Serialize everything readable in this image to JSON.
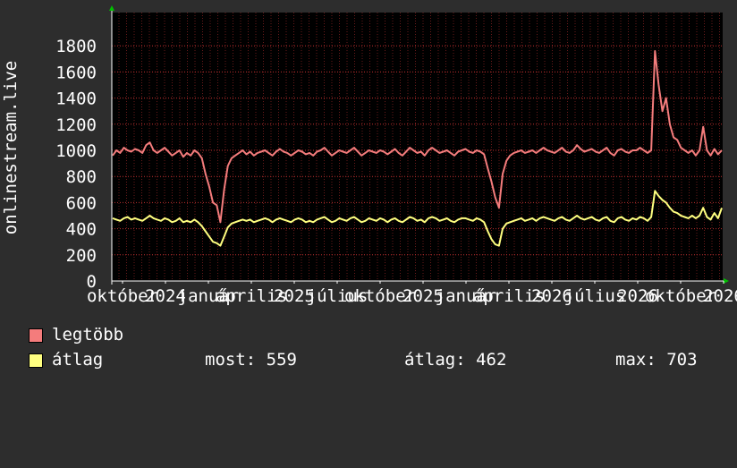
{
  "chart_data": {
    "type": "line",
    "ylabel": "onlinestream.live",
    "ylim": [
      0,
      2000
    ],
    "yticks": [
      0,
      200,
      400,
      600,
      800,
      1000,
      1200,
      1400,
      1600,
      1800
    ],
    "grid": true,
    "xtick_labels": [
      "október",
      "2024",
      "január",
      "április",
      "2025",
      "július",
      "október",
      "2025",
      "január",
      "április",
      "2026",
      "július",
      "2026",
      "október",
      "2026"
    ],
    "series": [
      {
        "name": "legtöbb",
        "color": "#f47c7c",
        "values": [
          960,
          1000,
          980,
          1020,
          1000,
          990,
          1010,
          1000,
          980,
          1040,
          1060,
          1000,
          980,
          1000,
          1020,
          990,
          960,
          980,
          1000,
          950,
          980,
          960,
          1000,
          980,
          940,
          820,
          720,
          600,
          580,
          450,
          700,
          880,
          940,
          960,
          980,
          1000,
          970,
          990,
          960,
          980,
          990,
          1000,
          980,
          960,
          990,
          1010,
          990,
          980,
          960,
          980,
          1000,
          990,
          970,
          980,
          960,
          990,
          1000,
          1020,
          990,
          960,
          980,
          1000,
          990,
          980,
          1000,
          1020,
          990,
          960,
          980,
          1000,
          990,
          980,
          1000,
          990,
          970,
          990,
          1010,
          980,
          960,
          990,
          1020,
          1000,
          980,
          990,
          960,
          1000,
          1020,
          1000,
          980,
          990,
          1000,
          980,
          960,
          990,
          1000,
          1010,
          990,
          980,
          1000,
          990,
          970,
          860,
          760,
          640,
          560,
          820,
          920,
          960,
          980,
          990,
          1000,
          980,
          990,
          1000,
          980,
          1000,
          1020,
          1000,
          990,
          980,
          1000,
          1020,
          990,
          980,
          1000,
          1040,
          1010,
          990,
          1000,
          1010,
          990,
          980,
          1000,
          1020,
          980,
          960,
          1000,
          1010,
          990,
          980,
          1000,
          1000,
          1020,
          1000,
          980,
          1000,
          1760,
          1500,
          1300,
          1400,
          1200,
          1100,
          1080,
          1020,
          1000,
          980,
          1000,
          960,
          1000,
          1180,
          1000,
          960,
          1010,
          970,
          1000
        ]
      },
      {
        "name": "átlag",
        "color": "#ffff80",
        "values": [
          480,
          470,
          460,
          480,
          490,
          470,
          480,
          470,
          460,
          480,
          500,
          480,
          470,
          460,
          480,
          470,
          450,
          460,
          480,
          450,
          460,
          450,
          470,
          450,
          420,
          380,
          340,
          300,
          290,
          270,
          340,
          410,
          440,
          450,
          460,
          470,
          460,
          470,
          450,
          460,
          470,
          480,
          470,
          450,
          470,
          480,
          470,
          460,
          450,
          470,
          480,
          470,
          450,
          460,
          450,
          470,
          480,
          490,
          470,
          450,
          460,
          480,
          470,
          460,
          480,
          490,
          470,
          450,
          460,
          480,
          470,
          460,
          480,
          470,
          450,
          470,
          480,
          460,
          450,
          470,
          490,
          480,
          460,
          470,
          450,
          480,
          490,
          480,
          460,
          470,
          480,
          460,
          450,
          470,
          480,
          480,
          470,
          460,
          480,
          470,
          450,
          380,
          320,
          280,
          270,
          400,
          440,
          450,
          460,
          470,
          480,
          460,
          470,
          480,
          460,
          480,
          490,
          480,
          470,
          460,
          480,
          490,
          470,
          460,
          480,
          500,
          480,
          470,
          480,
          490,
          470,
          460,
          480,
          490,
          460,
          450,
          480,
          490,
          470,
          460,
          480,
          470,
          490,
          480,
          460,
          490,
          690,
          650,
          620,
          600,
          560,
          530,
          520,
          500,
          490,
          480,
          500,
          480,
          500,
          560,
          490,
          470,
          520,
          480,
          559
        ]
      }
    ],
    "legend": [
      {
        "label": "legtöbb",
        "color": "#f47c7c"
      },
      {
        "label": "átlag",
        "color": "#ffff80"
      }
    ],
    "stats": [
      {
        "label": "most:",
        "value": "559"
      },
      {
        "label": "átlag:",
        "value": "462"
      },
      {
        "label": "max:",
        "value": "703"
      }
    ]
  },
  "colors": {
    "background": "#2d2d2d",
    "plot_background": "#000000",
    "grid": "#c03030",
    "axis": "#ffffff",
    "arrow": "#00c000"
  }
}
